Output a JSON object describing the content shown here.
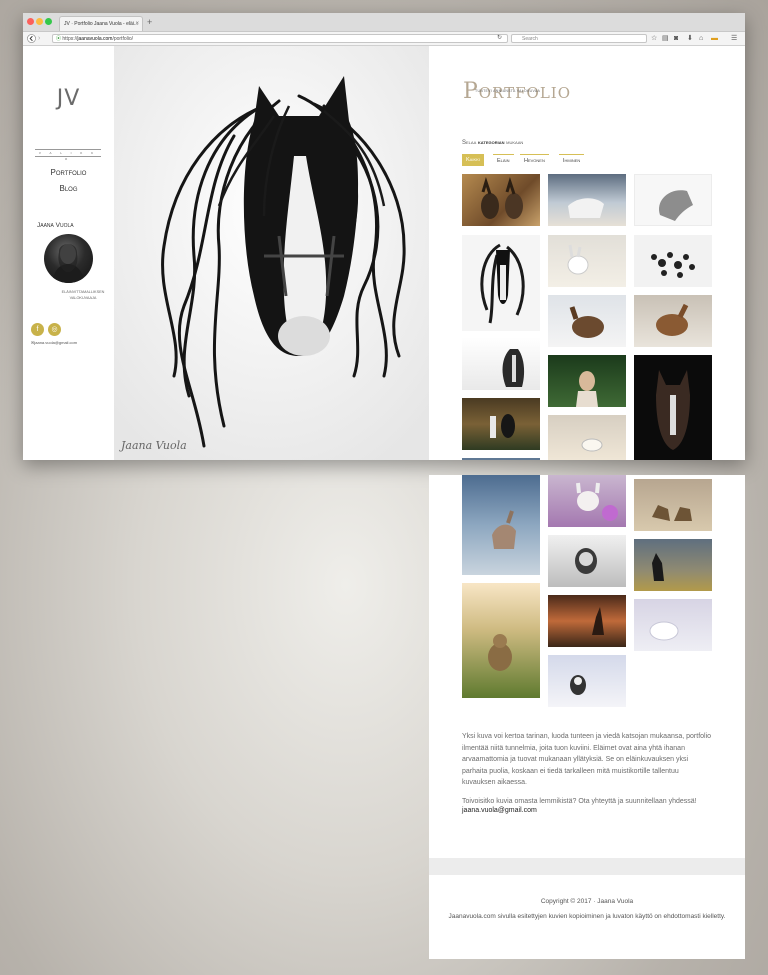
{
  "browser": {
    "tab_title": "JV · Portfolio Jaana Vuola - eläi...",
    "tab_close": "×",
    "new_tab": "+",
    "url_prefix": "https://",
    "url_domain": "jaanavuola.com",
    "url_path": "/portfolio/",
    "search_placeholder": "Search",
    "traffic_colors": [
      "#fc605b",
      "#fdbc40",
      "#34c84a"
    ]
  },
  "sidebar": {
    "logo": "JV",
    "divider_text": "V A L I K K O",
    "nav": [
      "Portfolio",
      "Blog"
    ],
    "author_name": "Jaana Vuola",
    "bio_line1": "ELÄINVITTAMALLIKSEN",
    "bio_line2": "VALOKUVAAJA",
    "email": "jaana.vuola@gmail.com"
  },
  "hero": {
    "signature": "Jaana Vuola"
  },
  "main": {
    "tagline": "TUNTEVI ANNIANSTA VALOKUVAA",
    "title": "Portfolio",
    "browse_prefix": "Selaa",
    "browse_bold": "kategorian",
    "browse_suffix": "mukaan",
    "filters": [
      {
        "label": "Kaikki",
        "active": true
      },
      {
        "label": "Eläin",
        "active": false
      },
      {
        "label": "Hevonen",
        "active": false
      },
      {
        "label": "Ihminen",
        "active": false
      }
    ]
  },
  "footer": {
    "intro": "Yksi kuva voi kertoa tarinan, luoda tunteen ja viedä katsojan mukaansa, portfolio ilmentää niitä tunnelmia, joita tuon kuviini. Eläimet ovat aina yhtä ihanan arvaamattomia ja tuovat mukanaan yllätyksiä. Se on eläinkuvauksen yksi parhaita puolia, koskaan ei tiedä tarkalleen mitä muistikortille tallentuu kuvauksen aikaessa.",
    "cta": "Toivoisitko kuvia omasta lemmikistä? Ota yhteyttä ja suunnitellaan yhdessä!",
    "contact_email": "jaana.vuola@gmail.com",
    "copyright": "Copyright © 2017 · Jaana Vuola",
    "legal": "Jaanavuola.com sivulla esitettyjen kuvien kopioiminen ja luvaton käyttö on ehdottomasti kielletty."
  },
  "colors": {
    "accent": "#d6bf56",
    "title": "#b5a792",
    "social": "#c8b24a"
  }
}
